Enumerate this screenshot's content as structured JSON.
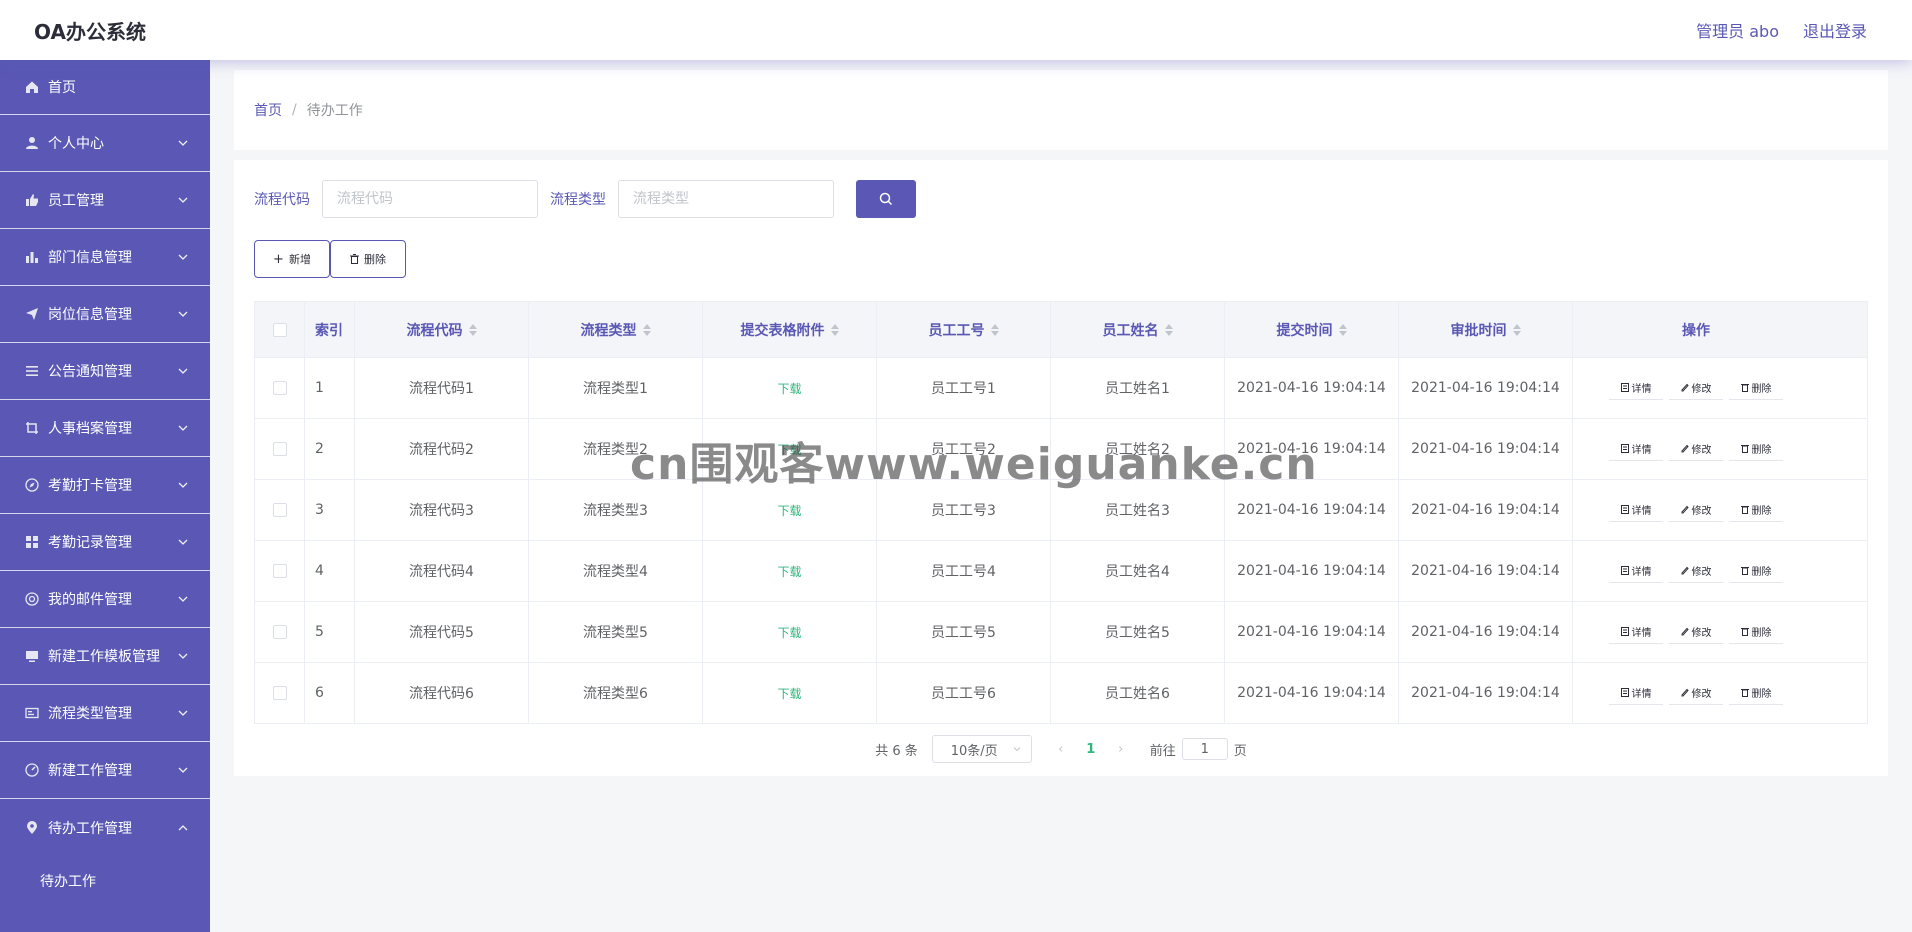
{
  "header": {
    "title": "OA办公系统",
    "user": "管理员 abo",
    "logout": "退出登录"
  },
  "sidebar": {
    "items": [
      {
        "label": "首页",
        "icon": "home-icon",
        "expandable": false
      },
      {
        "label": "个人中心",
        "icon": "user-icon",
        "expandable": true
      },
      {
        "label": "员工管理",
        "icon": "thumbs-up-icon",
        "expandable": true
      },
      {
        "label": "部门信息管理",
        "icon": "bar-chart-icon",
        "expandable": true
      },
      {
        "label": "岗位信息管理",
        "icon": "send-icon",
        "expandable": true
      },
      {
        "label": "公告通知管理",
        "icon": "list-icon",
        "expandable": true
      },
      {
        "label": "人事档案管理",
        "icon": "crop-icon",
        "expandable": true
      },
      {
        "label": "考勤打卡管理",
        "icon": "compass-icon",
        "expandable": true
      },
      {
        "label": "考勤记录管理",
        "icon": "grid-icon",
        "expandable": true
      },
      {
        "label": "我的邮件管理",
        "icon": "at-icon",
        "expandable": true
      },
      {
        "label": "新建工作模板管理",
        "icon": "monitor-icon",
        "expandable": true
      },
      {
        "label": "流程类型管理",
        "icon": "id-card-icon",
        "expandable": true
      },
      {
        "label": "新建工作管理",
        "icon": "dashboard-icon",
        "expandable": true
      },
      {
        "label": "待办工作管理",
        "icon": "location-icon",
        "expandable": true,
        "expanded": true
      }
    ],
    "submenu": [
      "待办工作"
    ]
  },
  "breadcrumb": {
    "home": "首页",
    "separator": "/",
    "current": "待办工作"
  },
  "search": {
    "code_label": "流程代码",
    "code_placeholder": "流程代码",
    "type_label": "流程类型",
    "type_placeholder": "流程类型"
  },
  "actions": {
    "add": "新增",
    "delete": "删除"
  },
  "table": {
    "columns": [
      "索引",
      "流程代码",
      "流程类型",
      "提交表格附件",
      "员工工号",
      "员工姓名",
      "提交时间",
      "审批时间",
      "操作"
    ],
    "rows": [
      [
        "1",
        "流程代码1",
        "流程类型1",
        "下载",
        "员工工号1",
        "员工姓名1",
        "2021-04-16 19:04:14",
        "2021-04-16 19:04:14"
      ],
      [
        "2",
        "流程代码2",
        "流程类型2",
        "下载",
        "员工工号2",
        "员工姓名2",
        "2021-04-16 19:04:14",
        "2021-04-16 19:04:14"
      ],
      [
        "3",
        "流程代码3",
        "流程类型3",
        "下载",
        "员工工号3",
        "员工姓名3",
        "2021-04-16 19:04:14",
        "2021-04-16 19:04:14"
      ],
      [
        "4",
        "流程代码4",
        "流程类型4",
        "下载",
        "员工工号4",
        "员工姓名4",
        "2021-04-16 19:04:14",
        "2021-04-16 19:04:14"
      ],
      [
        "5",
        "流程代码5",
        "流程类型5",
        "下载",
        "员工工号5",
        "员工姓名5",
        "2021-04-16 19:04:14",
        "2021-04-16 19:04:14"
      ],
      [
        "6",
        "流程代码6",
        "流程类型6",
        "下载",
        "员工工号6",
        "员工姓名6",
        "2021-04-16 19:04:14",
        "2021-04-16 19:04:14"
      ]
    ],
    "row_actions": [
      "详情",
      "修改",
      "删除"
    ]
  },
  "pagination": {
    "total": "共 6 条",
    "page_size": "10条/页",
    "current_page": "1",
    "goto_prefix": "前往",
    "goto_value": "1",
    "goto_suffix": "页"
  },
  "watermark": "cn围观客www.weiguanke.cn",
  "colors": {
    "primary": "#5a58b4",
    "download": "#2fb67c",
    "background": "#f5f6f8"
  }
}
